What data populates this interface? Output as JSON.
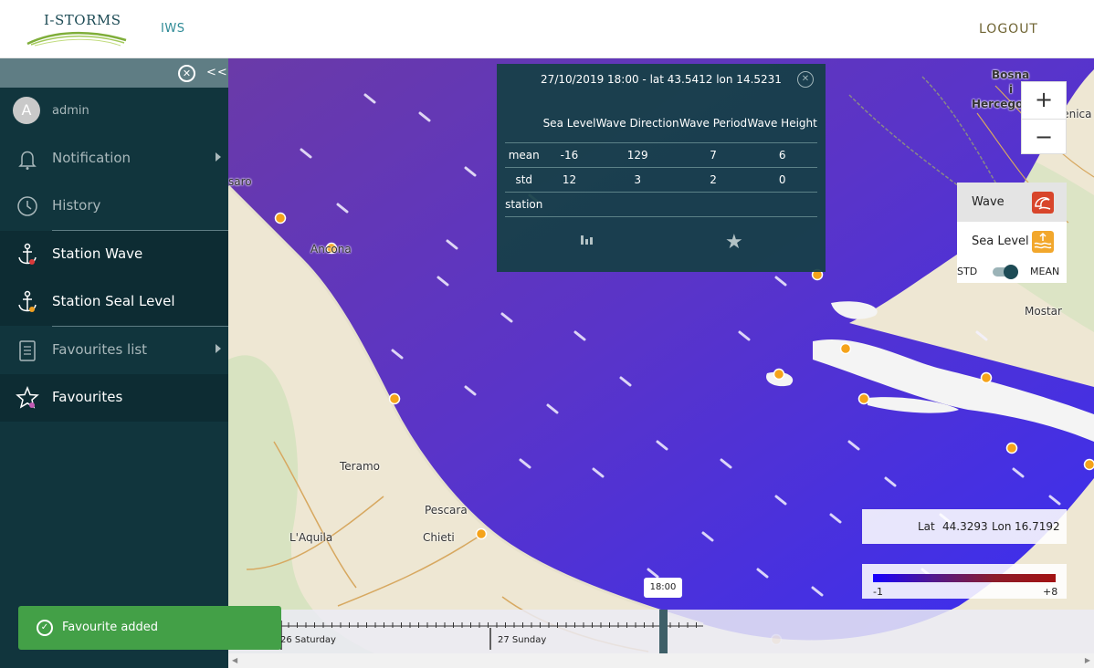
{
  "header": {
    "logo_text": "I-STORMS",
    "nav_iws": "IWS",
    "logout": "LOGOUT"
  },
  "sidebar": {
    "collapse_label": "<<",
    "user": {
      "avatar_letter": "A",
      "name": "admin"
    },
    "items": [
      {
        "label": "Notification",
        "icon": "bell-icon"
      },
      {
        "label": "History",
        "icon": "clock-icon"
      },
      {
        "label": "Station Wave",
        "icon": "anchor-icon"
      },
      {
        "label": "Station Seal Level",
        "icon": "anchor-icon"
      },
      {
        "label": "Favourites list",
        "icon": "list-icon"
      },
      {
        "label": "Favourites",
        "icon": "star-icon"
      }
    ]
  },
  "map": {
    "places": {
      "ancona": "Ancona",
      "pesaro": "saro",
      "teramo": "Teramo",
      "pescara": "Pescara",
      "chieti": "Chieti",
      "laquila": "L'Aquila",
      "bosna": "Bosna",
      "i": "i",
      "hercegovina": "Hercegovina",
      "zenica": "Zenica",
      "mostar": "Mostar"
    }
  },
  "popup": {
    "title": "27/10/2019 18:00 - lat 43.5412 lon 14.5231",
    "headers": [
      "Sea Level",
      "Wave Direction",
      "Wave Period",
      "Wave Height"
    ],
    "rows": [
      {
        "label": "mean",
        "values": [
          "-16",
          "129",
          "7",
          "6"
        ]
      },
      {
        "label": "std",
        "values": [
          "12",
          "3",
          "2",
          "0"
        ]
      },
      {
        "label": "station",
        "values": [
          "",
          "",
          "",
          ""
        ]
      }
    ]
  },
  "controls": {
    "zoom_in": "+",
    "zoom_out": "−",
    "layer_wave": "Wave",
    "layer_sea_level": "Sea Level",
    "toggle_std": "STD",
    "toggle_mean": "MEAN",
    "toggle_state": "MEAN"
  },
  "coords": {
    "lat_label": "Lat",
    "lat": "44.3293",
    "lon_label": "Lon",
    "lon": "16.7192"
  },
  "legend": {
    "min": "-1",
    "max": "+8",
    "colors": [
      "#1800ff",
      "#52188c",
      "#8c1c2a",
      "#a31212"
    ]
  },
  "timeline": {
    "day1": "26 Saturday",
    "day2": "27 Sunday",
    "current_time": "18:00"
  },
  "toast": {
    "message": "Favourite added",
    "color": "#43a047"
  },
  "colors": {
    "sidebar": "#11353d",
    "accent": "#2e8a96",
    "sea": "#4a2fd6"
  }
}
